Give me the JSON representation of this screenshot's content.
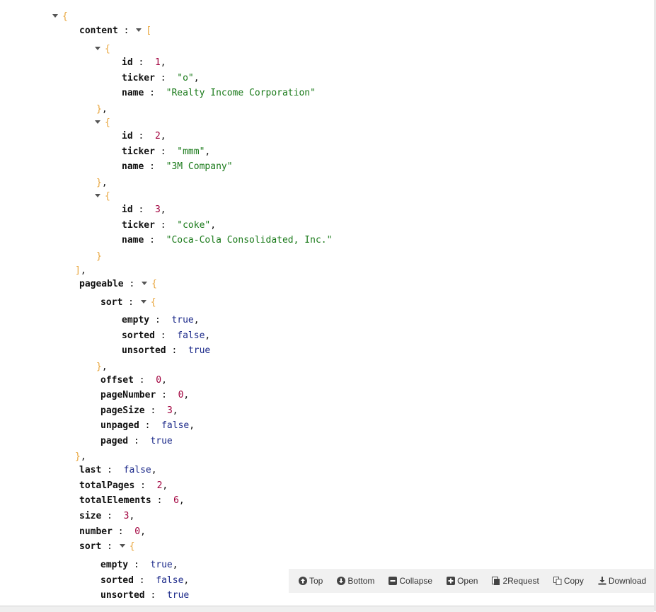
{
  "json_lines": [
    {
      "indent": 0,
      "toggle": true,
      "parts": [
        [
          "br",
          "{"
        ]
      ]
    },
    {
      "indent": 1,
      "toggle": false,
      "parts": [
        [
          "key",
          "content"
        ],
        [
          "sep",
          " : "
        ],
        [
          "tog",
          ""
        ],
        [
          "br",
          "["
        ]
      ]
    },
    {
      "indent": 2,
      "toggle": true,
      "parts": [
        [
          "br",
          "{"
        ]
      ]
    },
    {
      "indent": 3,
      "toggle": false,
      "parts": [
        [
          "key",
          "id"
        ],
        [
          "sep",
          " :  "
        ],
        [
          "num",
          "1"
        ],
        [
          "pn",
          ","
        ]
      ]
    },
    {
      "indent": 3,
      "toggle": false,
      "parts": [
        [
          "key",
          "ticker"
        ],
        [
          "sep",
          " :  "
        ],
        [
          "str",
          "\"o\""
        ],
        [
          "pn",
          ","
        ]
      ]
    },
    {
      "indent": 3,
      "toggle": false,
      "parts": [
        [
          "key",
          "name"
        ],
        [
          "sep",
          " :  "
        ],
        [
          "str",
          "\"Realty Income Corporation\""
        ]
      ]
    },
    {
      "indent": 2,
      "toggle": false,
      "parts": [
        [
          "br",
          "}"
        ],
        [
          "pn",
          ","
        ]
      ]
    },
    {
      "indent": 2,
      "toggle": true,
      "parts": [
        [
          "br",
          "{"
        ]
      ]
    },
    {
      "indent": 3,
      "toggle": false,
      "parts": [
        [
          "key",
          "id"
        ],
        [
          "sep",
          " :  "
        ],
        [
          "num",
          "2"
        ],
        [
          "pn",
          ","
        ]
      ]
    },
    {
      "indent": 3,
      "toggle": false,
      "parts": [
        [
          "key",
          "ticker"
        ],
        [
          "sep",
          " :  "
        ],
        [
          "str",
          "\"mmm\""
        ],
        [
          "pn",
          ","
        ]
      ]
    },
    {
      "indent": 3,
      "toggle": false,
      "parts": [
        [
          "key",
          "name"
        ],
        [
          "sep",
          " :  "
        ],
        [
          "str",
          "\"3M Company\""
        ]
      ]
    },
    {
      "indent": 2,
      "toggle": false,
      "parts": [
        [
          "br",
          "}"
        ],
        [
          "pn",
          ","
        ]
      ]
    },
    {
      "indent": 2,
      "toggle": true,
      "parts": [
        [
          "br",
          "{"
        ]
      ]
    },
    {
      "indent": 3,
      "toggle": false,
      "parts": [
        [
          "key",
          "id"
        ],
        [
          "sep",
          " :  "
        ],
        [
          "num",
          "3"
        ],
        [
          "pn",
          ","
        ]
      ]
    },
    {
      "indent": 3,
      "toggle": false,
      "parts": [
        [
          "key",
          "ticker"
        ],
        [
          "sep",
          " :  "
        ],
        [
          "str",
          "\"coke\""
        ],
        [
          "pn",
          ","
        ]
      ]
    },
    {
      "indent": 3,
      "toggle": false,
      "parts": [
        [
          "key",
          "name"
        ],
        [
          "sep",
          " :  "
        ],
        [
          "str",
          "\"Coca-Cola Consolidated, Inc.\""
        ]
      ]
    },
    {
      "indent": 2,
      "toggle": false,
      "parts": [
        [
          "br",
          "}"
        ]
      ]
    },
    {
      "indent": 1,
      "toggle": false,
      "parts": [
        [
          "br",
          "]"
        ],
        [
          "pn",
          ","
        ]
      ]
    },
    {
      "indent": 1,
      "toggle": false,
      "parts": [
        [
          "key",
          "pageable"
        ],
        [
          "sep",
          " : "
        ],
        [
          "tog",
          ""
        ],
        [
          "br",
          "{"
        ]
      ]
    },
    {
      "indent": 2,
      "toggle": false,
      "parts": [
        [
          "key",
          "sort"
        ],
        [
          "sep",
          " : "
        ],
        [
          "tog",
          ""
        ],
        [
          "br",
          "{"
        ]
      ]
    },
    {
      "indent": 3,
      "toggle": false,
      "parts": [
        [
          "key",
          "empty"
        ],
        [
          "sep",
          " :  "
        ],
        [
          "bool",
          "true"
        ],
        [
          "pn",
          ","
        ]
      ]
    },
    {
      "indent": 3,
      "toggle": false,
      "parts": [
        [
          "key",
          "sorted"
        ],
        [
          "sep",
          " :  "
        ],
        [
          "bool",
          "false"
        ],
        [
          "pn",
          ","
        ]
      ]
    },
    {
      "indent": 3,
      "toggle": false,
      "parts": [
        [
          "key",
          "unsorted"
        ],
        [
          "sep",
          " :  "
        ],
        [
          "bool",
          "true"
        ]
      ]
    },
    {
      "indent": 2,
      "toggle": false,
      "parts": [
        [
          "br",
          "}"
        ],
        [
          "pn",
          ","
        ]
      ]
    },
    {
      "indent": 2,
      "toggle": false,
      "parts": [
        [
          "key",
          "offset"
        ],
        [
          "sep",
          " :  "
        ],
        [
          "num",
          "0"
        ],
        [
          "pn",
          ","
        ]
      ]
    },
    {
      "indent": 2,
      "toggle": false,
      "parts": [
        [
          "key",
          "pageNumber"
        ],
        [
          "sep",
          " :  "
        ],
        [
          "num",
          "0"
        ],
        [
          "pn",
          ","
        ]
      ]
    },
    {
      "indent": 2,
      "toggle": false,
      "parts": [
        [
          "key",
          "pageSize"
        ],
        [
          "sep",
          " :  "
        ],
        [
          "num",
          "3"
        ],
        [
          "pn",
          ","
        ]
      ]
    },
    {
      "indent": 2,
      "toggle": false,
      "parts": [
        [
          "key",
          "unpaged"
        ],
        [
          "sep",
          " :  "
        ],
        [
          "bool",
          "false"
        ],
        [
          "pn",
          ","
        ]
      ]
    },
    {
      "indent": 2,
      "toggle": false,
      "parts": [
        [
          "key",
          "paged"
        ],
        [
          "sep",
          " :  "
        ],
        [
          "bool",
          "true"
        ]
      ]
    },
    {
      "indent": 1,
      "toggle": false,
      "parts": [
        [
          "br",
          "}"
        ],
        [
          "pn",
          ","
        ]
      ]
    },
    {
      "indent": 1,
      "toggle": false,
      "parts": [
        [
          "key",
          "last"
        ],
        [
          "sep",
          " :  "
        ],
        [
          "bool",
          "false"
        ],
        [
          "pn",
          ","
        ]
      ]
    },
    {
      "indent": 1,
      "toggle": false,
      "parts": [
        [
          "key",
          "totalPages"
        ],
        [
          "sep",
          " :  "
        ],
        [
          "num",
          "2"
        ],
        [
          "pn",
          ","
        ]
      ]
    },
    {
      "indent": 1,
      "toggle": false,
      "parts": [
        [
          "key",
          "totalElements"
        ],
        [
          "sep",
          " :  "
        ],
        [
          "num",
          "6"
        ],
        [
          "pn",
          ","
        ]
      ]
    },
    {
      "indent": 1,
      "toggle": false,
      "parts": [
        [
          "key",
          "size"
        ],
        [
          "sep",
          " :  "
        ],
        [
          "num",
          "3"
        ],
        [
          "pn",
          ","
        ]
      ]
    },
    {
      "indent": 1,
      "toggle": false,
      "parts": [
        [
          "key",
          "number"
        ],
        [
          "sep",
          " :  "
        ],
        [
          "num",
          "0"
        ],
        [
          "pn",
          ","
        ]
      ]
    },
    {
      "indent": 1,
      "toggle": false,
      "parts": [
        [
          "key",
          "sort"
        ],
        [
          "sep",
          " : "
        ],
        [
          "tog",
          ""
        ],
        [
          "br",
          "{"
        ]
      ]
    },
    {
      "indent": 2,
      "toggle": false,
      "parts": [
        [
          "key",
          "empty"
        ],
        [
          "sep",
          " :  "
        ],
        [
          "bool",
          "true"
        ],
        [
          "pn",
          ","
        ]
      ]
    },
    {
      "indent": 2,
      "toggle": false,
      "parts": [
        [
          "key",
          "sorted"
        ],
        [
          "sep",
          " :  "
        ],
        [
          "bool",
          "false"
        ],
        [
          "pn",
          ","
        ]
      ]
    },
    {
      "indent": 2,
      "toggle": false,
      "parts": [
        [
          "key",
          "unsorted"
        ],
        [
          "sep",
          " :  "
        ],
        [
          "bool",
          "true"
        ]
      ]
    }
  ],
  "toolbar": {
    "top": {
      "label": "Top",
      "icon": "arrow-up-circle-icon"
    },
    "bottom": {
      "label": "Bottom",
      "icon": "arrow-down-circle-icon"
    },
    "collapse": {
      "label": "Collapse",
      "icon": "minus-square-icon"
    },
    "open": {
      "label": "Open",
      "icon": "plus-square-icon"
    },
    "request": {
      "label": "2Request",
      "icon": "request-doc-icon"
    },
    "copy": {
      "label": "Copy",
      "icon": "copy-icon"
    },
    "download": {
      "label": "Download",
      "icon": "download-icon"
    }
  },
  "colors": {
    "key": "#111111",
    "number": "#a1003d",
    "string": "#1a7a1a",
    "boolean": "#1c2a8a",
    "bracket": "#e8a43a"
  }
}
